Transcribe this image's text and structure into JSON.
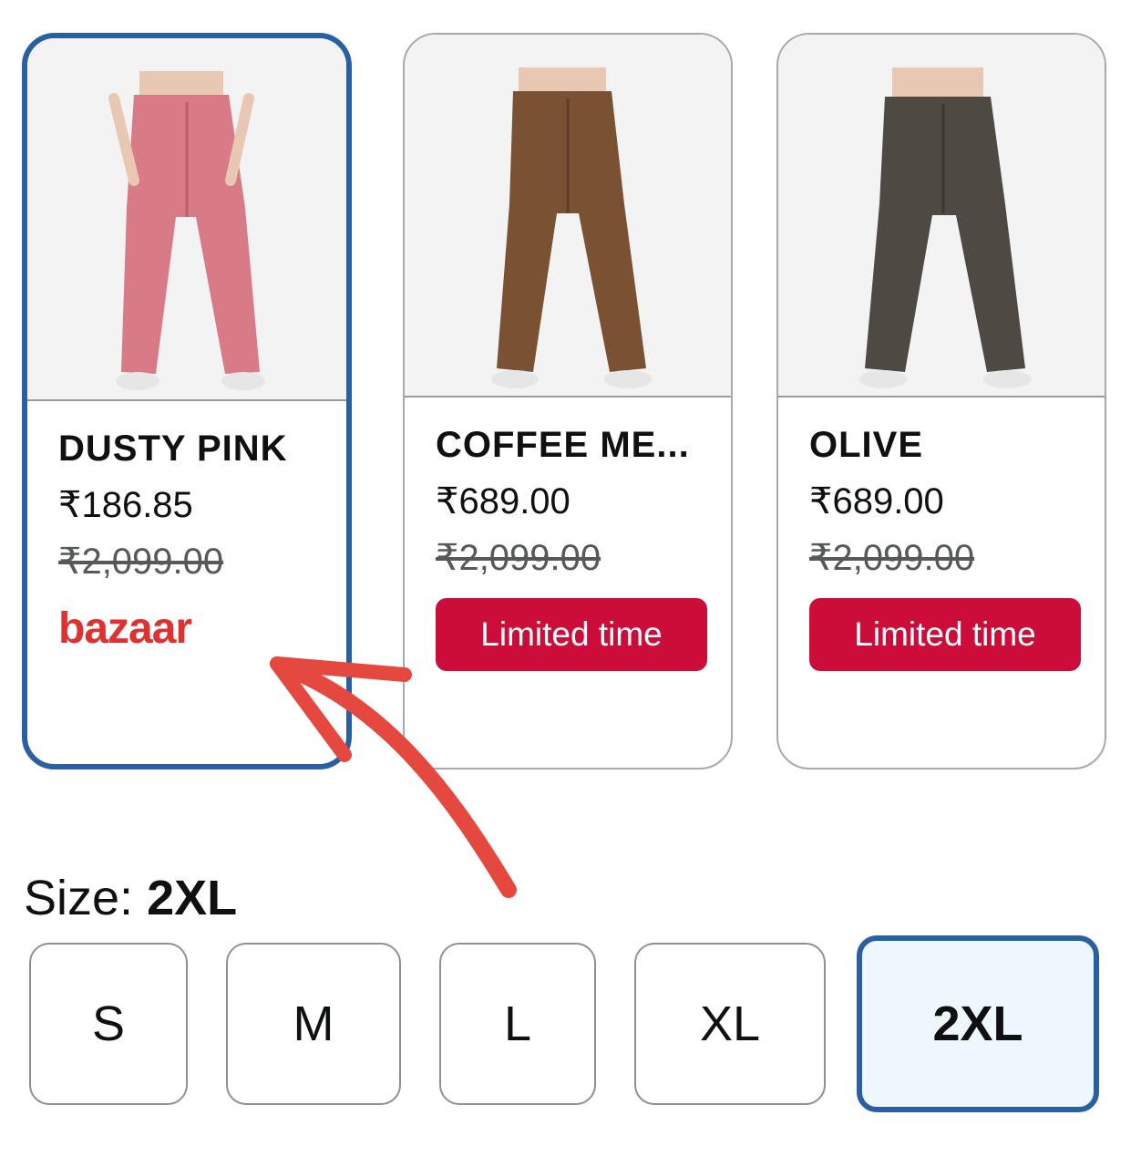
{
  "products": [
    {
      "color_name": "DUSTY PINK",
      "price": "₹186.85",
      "old_price": "₹2,099.00",
      "brand_badge": "bazaar",
      "image_color": "#d97b86",
      "selected": true
    },
    {
      "color_name": "COFFEE ME...",
      "price": "₹689.00",
      "old_price": "₹2,099.00",
      "deal_badge": "Limited time",
      "image_color": "#7a5233",
      "selected": false
    },
    {
      "color_name": "OLIVE",
      "price": "₹689.00",
      "old_price": "₹2,099.00",
      "deal_badge": "Limited time",
      "image_color": "#4f4944",
      "selected": false
    }
  ],
  "size": {
    "label": "Size:",
    "selected": "2XL",
    "options": [
      "S",
      "M",
      "L",
      "XL",
      "2XL"
    ]
  },
  "colors": {
    "selected_border": "#2a5fa1",
    "deal_badge": "#cc0c39",
    "annotation_arrow": "#e5483f"
  }
}
